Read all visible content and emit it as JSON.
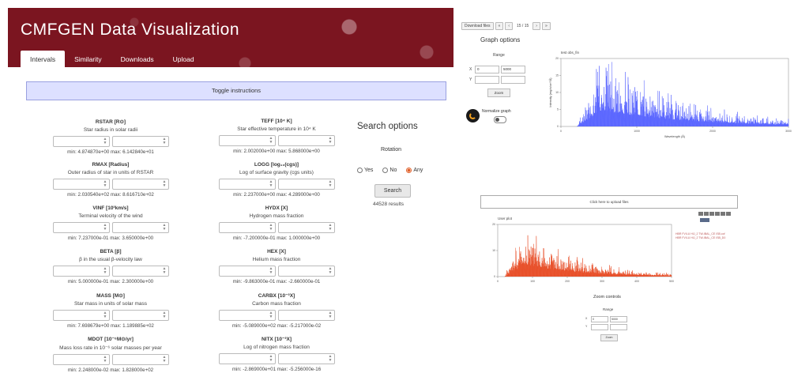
{
  "app": {
    "title": "CMFGEN Data Visualization",
    "tabs": [
      "Intervals",
      "Similarity",
      "Downloads",
      "Upload"
    ],
    "toggle_label": "Toggle instructions"
  },
  "params": [
    {
      "name": "RSTAR [R⊙]",
      "desc": "Star radius in solar radii",
      "range": "min: 4.874870e+00 max: 6.142840e+01"
    },
    {
      "name": "TEFF [10⁴ K]",
      "desc": "Star effective temperature in 10⁴ K",
      "range": "min: 2.002000e+00 max: 5.868000e+00"
    },
    {
      "name": "RMAX [Radius]",
      "desc": "Outer radius of star in units of RSTAR",
      "range": "min: 2.030540e+02 max: 8.616710e+02"
    },
    {
      "name": "LOGG [log₁₀(cgs)]",
      "desc": "Log of surface gravity (cgs units)",
      "range": "min: 2.237000e+00 max: 4.289000e+00"
    },
    {
      "name": "VINF [10³km/s]",
      "desc": "Terminal velocity of the wind",
      "range": "min: 7.237000e-01 max: 3.650000e+00"
    },
    {
      "name": "HYDX [X]",
      "desc": "Hydrogen mass fraction",
      "range": "min: -7.200000e-01 max: 1.000000e+00"
    },
    {
      "name": "BETA [β]",
      "desc": "β in the usual β-velocity law",
      "range": "min: 5.000000e-01 max: 2.300000e+00"
    },
    {
      "name": "HEX [X]",
      "desc": "Helium mass fraction",
      "range": "min: -9.863000e-01 max: -2.660000e-01"
    },
    {
      "name": "MASS [M⊙]",
      "desc": "Star mass in units of solar mass",
      "range": "min: 7.698679e+00 max: 1.189885e+02"
    },
    {
      "name": "CARBX [10⁻³X]",
      "desc": "Carbon mass fraction",
      "range": "min: -5.089000e+02 max: -5.217000e-02"
    },
    {
      "name": "MDOT [10⁻⁶M⊙/yr]",
      "desc": "Mass loss rate in 10⁻⁶ solar masses per year",
      "range": "min: 2.248000e-02 max: 1.828000e+02"
    },
    {
      "name": "NITX [10⁻³X]",
      "desc": "Log of nitrogen mass fraction",
      "range": "min: -2.869000e+01 max: -5.256000e-16"
    }
  ],
  "search": {
    "title": "Search options",
    "rotation_label": "Rotation",
    "options": [
      "Yes",
      "No",
      "Any"
    ],
    "selected": "Any",
    "button": "Search",
    "results": "44528 results"
  },
  "graph_panel": {
    "download_label": "Download files",
    "page_indicator": "15 / 15",
    "title": "Graph options",
    "range_label": "Range",
    "x_label": "X",
    "y_label": "Y",
    "x_min": "0",
    "x_max": "5000",
    "zoom_label": "Zoom",
    "normalize_label": "Normalize graph",
    "plot_title": "test obs_fin",
    "plot_xlabel": "Wavelength (Å)",
    "plot_ylabel": "Intensity (erg/s/cm²/Å)",
    "x_ticks": [
      "0",
      "1000",
      "2000",
      "3000"
    ],
    "y_ticks": [
      "20",
      "15",
      "10",
      "5",
      "0"
    ],
    "color": "#5b67ff"
  },
  "upload_panel": {
    "upload_label": "Click here to upload files",
    "plot_title": "User plot",
    "legend": [
      "HBR FV/LU HIJ_2 TW-IBAL_CE ISB.cof",
      "HBR FV/LU HIJ_2 TW-IBAL_CE ISB_D0"
    ],
    "x_ticks": [
      "0",
      "100",
      "200",
      "300",
      "400",
      "500"
    ],
    "y_ticks": [
      "20",
      "10",
      "0"
    ],
    "zoom_title": "Zoom controls",
    "range_label": "Range",
    "x_label": "X",
    "y_label": "Y",
    "x_min": "0",
    "x_max": "5000",
    "zoom_label": "Zoom",
    "color": "#e8502a"
  }
}
